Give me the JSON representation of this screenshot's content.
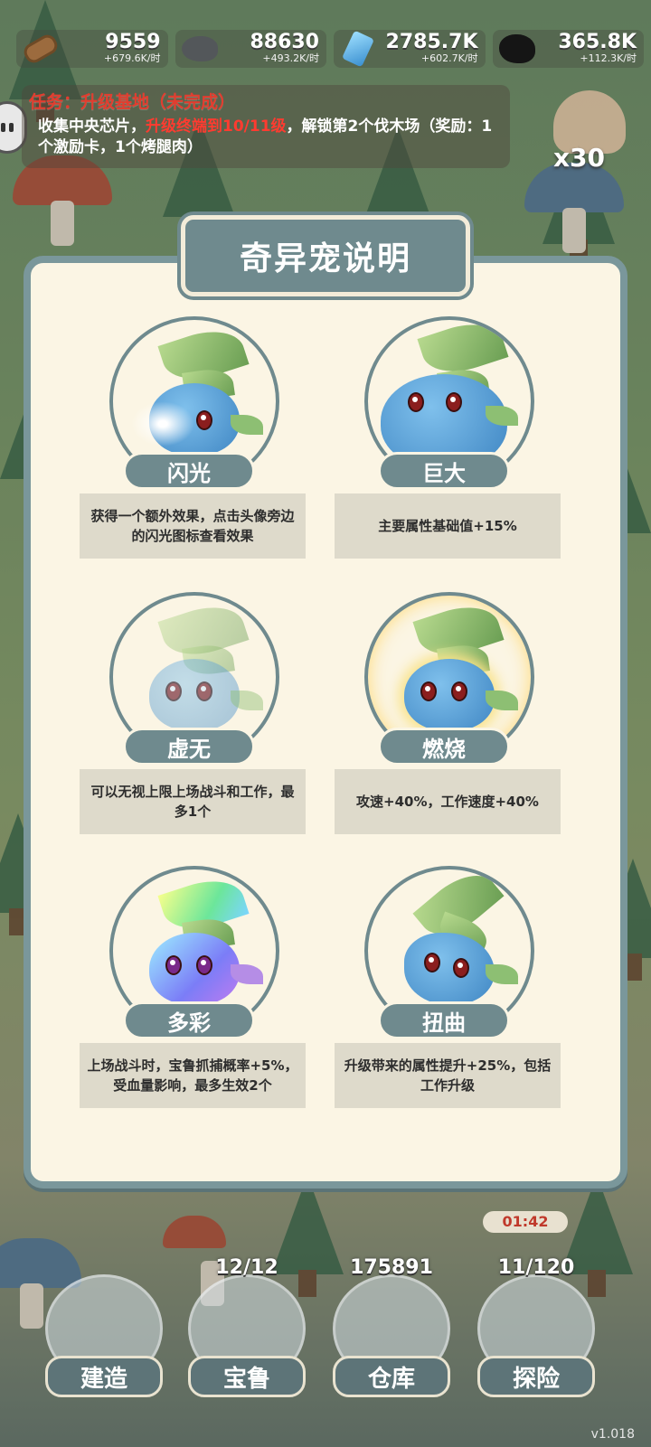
{
  "resources": [
    {
      "icon": "wood-log-icon",
      "value": "9559",
      "rate": "+679.6K/时"
    },
    {
      "icon": "stone-icon",
      "value": "88630",
      "rate": "+493.2K/时"
    },
    {
      "icon": "crystal-icon",
      "value": "2785.7K",
      "rate": "+602.7K/时"
    },
    {
      "icon": "coal-icon",
      "value": "365.8K",
      "rate": "+112.3K/时"
    }
  ],
  "quest": {
    "title": "任务：升级基地（未完成）",
    "desc_pre": "收集中央芯片，",
    "desc_highlight": "升级终端到10/11级",
    "desc_post": "，解锁第2个伐木场（奖励：1个激励卡，1个烤腿肉）"
  },
  "glove_count": "x30",
  "modal": {
    "title": "奇异宠说明",
    "pets": [
      {
        "name": "闪光",
        "desc": "获得一个额外效果，点击头像旁边的闪光图标查看效果"
      },
      {
        "name": "巨大",
        "desc": "主要属性基础值+15%"
      },
      {
        "name": "虚无",
        "desc": "可以无视上限上场战斗和工作，最多1个"
      },
      {
        "name": "燃烧",
        "desc": "攻速+40%，工作速度+40%"
      },
      {
        "name": "多彩",
        "desc": "上场战斗时，宝鲁抓捕概率+5%，受血量影响，最多生效2个"
      },
      {
        "name": "扭曲",
        "desc": "升级带来的属性提升+25%，包括工作升级"
      }
    ]
  },
  "nav": [
    {
      "label": "建造",
      "count": ""
    },
    {
      "label": "宝鲁",
      "count": "12/12"
    },
    {
      "label": "仓库",
      "count": "175891"
    },
    {
      "label": "探险",
      "count": "11/120",
      "timer": "01:42"
    }
  ],
  "version": "v1.018"
}
